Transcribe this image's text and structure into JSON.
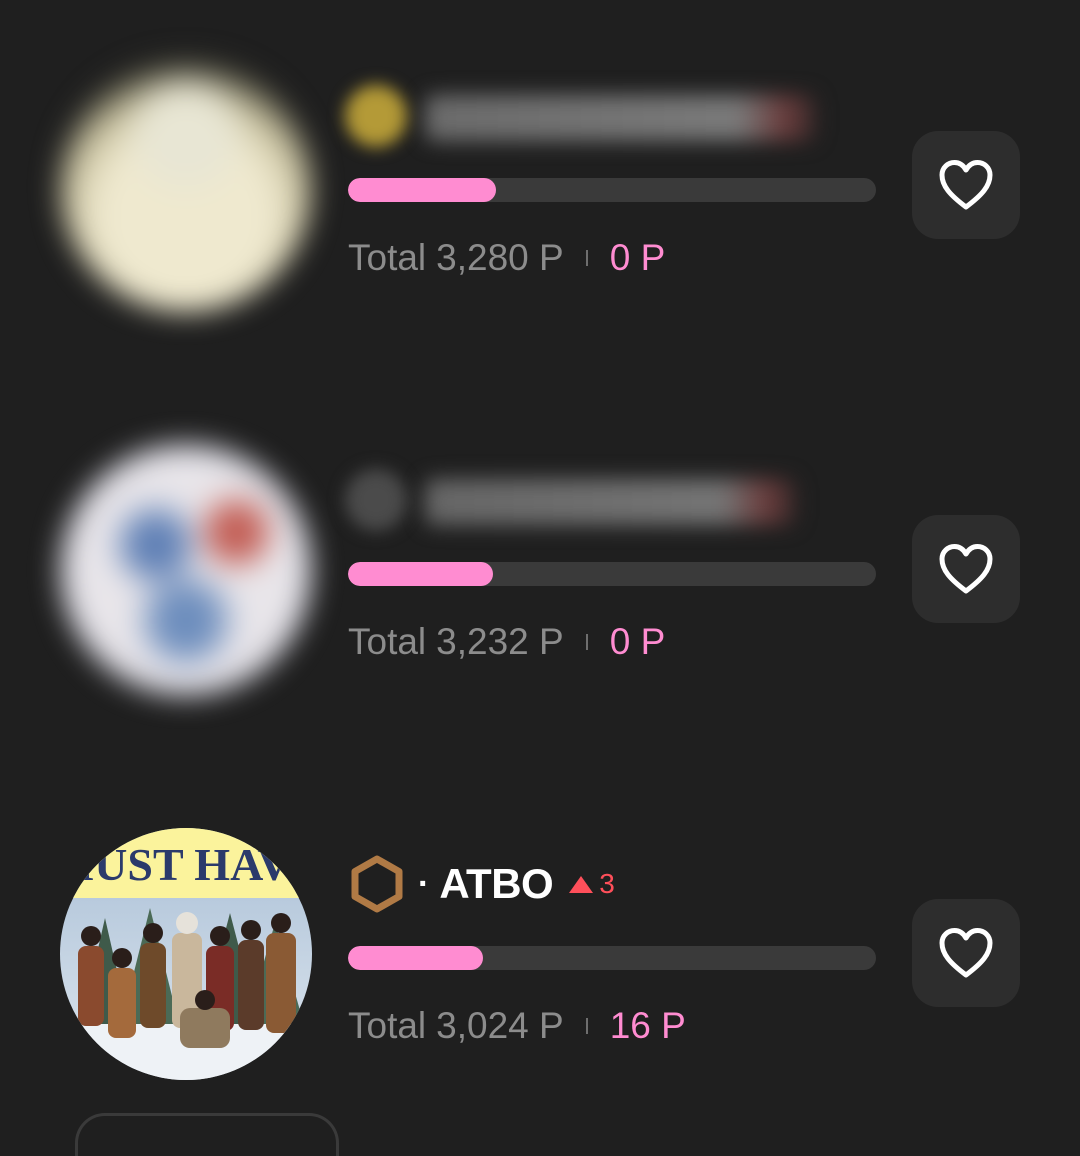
{
  "colors": {
    "background": "#1f1f1f",
    "progress_fill": "#ff8cd1",
    "progress_track": "#3a3a3a",
    "points_accent": "#ff8cd1",
    "rank_up": "#ff4f5a",
    "muted_text": "#8c8c8c",
    "like_button_bg": "#2d2d2d"
  },
  "ranking": [
    {
      "artist_name": "",
      "name_blurred": true,
      "avatar_blurred": true,
      "total_label": "Total",
      "total_points": "3,280 P",
      "earned_points": "0 P",
      "progress_fraction": 0.28,
      "like_icon": "heart-outline-icon"
    },
    {
      "artist_name": "",
      "name_blurred": true,
      "avatar_blurred": true,
      "total_label": "Total",
      "total_points": "3,232 P",
      "earned_points": "0 P",
      "progress_fraction": 0.275,
      "like_icon": "heart-outline-icon"
    },
    {
      "artist_name": "ATBO",
      "name_blurred": false,
      "avatar_blurred": false,
      "avatar_text": "MUST HAVE",
      "tier_icon": "bronze-hexagon-icon",
      "separator": "·",
      "rank_change": "3",
      "rank_change_icon": "up-arrow-icon",
      "total_label": "Total",
      "total_points": "3,024 P",
      "earned_points": "16 P",
      "progress_fraction": 0.255,
      "like_icon": "heart-outline-icon"
    }
  ]
}
